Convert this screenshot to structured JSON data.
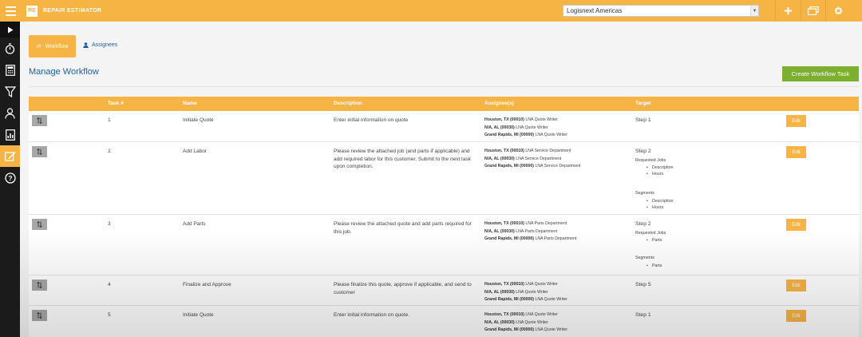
{
  "app": {
    "logo_text": "RE",
    "title": "REPAIR ESTIMATOR",
    "company_selected": "Logisnext Americas"
  },
  "tabs": {
    "workflow": "Workflow",
    "assignees": "Assignees"
  },
  "page": {
    "title": "Manage Workflow",
    "create_button": "Create Workflow Task"
  },
  "table": {
    "headers": [
      "Task #",
      "Name",
      "Description",
      "Assignee(s)",
      "Target"
    ],
    "edit_label": "Edit",
    "rows": [
      {
        "num": "1",
        "name": "Initiate Quote",
        "description": "Enter initial information on quote",
        "assignees": [
          {
            "loc": "Houston, TX (00010)",
            "role": "LNA Quote Writer"
          },
          {
            "loc": "N/A, AL (00030)",
            "role": "LNA Quote Writer"
          },
          {
            "loc": "Grand Rapids, MI (00000)",
            "role": "LNA Quote Writer"
          }
        ],
        "target": {
          "step": "Step 1",
          "requested_label": "",
          "requested": [],
          "segments_label": "",
          "segments": []
        }
      },
      {
        "num": "2",
        "name": "Add Labor",
        "description": "Please review the attached job (and parts if applicable) and add required labor for this customer. Submit to the next task upon completion.",
        "assignees": [
          {
            "loc": "Houston, TX (00010)",
            "role": "LNA Service Department"
          },
          {
            "loc": "N/A, AL (00030)",
            "role": "LNA Service Department"
          },
          {
            "loc": "Grand Rapids, MI (00000)",
            "role": "LNA Service Department"
          }
        ],
        "target": {
          "step": "Step 2",
          "requested_label": "Requested Jobs",
          "requested": [
            "Description",
            "Hours"
          ],
          "segments_label": "Segments",
          "segments": [
            "Description",
            "Hours"
          ]
        }
      },
      {
        "num": "3",
        "name": "Add Parts",
        "description": "Please review the attached quote and add parts required for this job.",
        "assignees": [
          {
            "loc": "Houston, TX (00010)",
            "role": "LNA Parts Department"
          },
          {
            "loc": "N/A, AL (00030)",
            "role": "LNA Parts Department"
          },
          {
            "loc": "Grand Rapids, MI (00000)",
            "role": "LNA Parts Department"
          }
        ],
        "target": {
          "step": "Step 2",
          "requested_label": "Requested Jobs",
          "requested": [
            "Parts"
          ],
          "segments_label": "Segments",
          "segments": [
            "Parts"
          ]
        }
      },
      {
        "num": "4",
        "name": "Finalize and Approve",
        "description": "Please finalize this quote, approve if applicable, and send to customer",
        "assignees": [
          {
            "loc": "Houston, TX (00010)",
            "role": "LNA Quote Writer"
          },
          {
            "loc": "N/A, AL (00030)",
            "role": "LNA Quote Writer"
          },
          {
            "loc": "Grand Rapids, MI (00000)",
            "role": "LNA Quote Writer"
          }
        ],
        "target": {
          "step": "Step 5",
          "requested_label": "",
          "requested": [],
          "segments_label": "",
          "segments": []
        }
      },
      {
        "num": "5",
        "name": "Initiate Quote",
        "description": "Enter initial information on quote.",
        "assignees": [
          {
            "loc": "Houston, TX (00010)",
            "role": "LNA Quote Writer"
          },
          {
            "loc": "N/A, AL (00030)",
            "role": "LNA Quote Writer"
          },
          {
            "loc": "Grand Rapids, MI (00000)",
            "role": "LNA Quote Writer"
          }
        ],
        "target": {
          "step": "Step 1",
          "requested_label": "",
          "requested": [],
          "segments_label": "",
          "segments": []
        }
      }
    ]
  },
  "icons": {
    "sidebar": [
      "play-icon",
      "stopwatch-icon",
      "calculator-icon",
      "filter-icon",
      "user-icon",
      "report-icon",
      "edit-icon",
      "help-icon"
    ],
    "topbar": [
      "plus-icon",
      "cards-icon",
      "gear-icon"
    ]
  },
  "colors": {
    "accent": "#f6b445",
    "sidebar": "#1b1b1b",
    "link": "#1f5e9c",
    "create": "#7cae2f"
  }
}
